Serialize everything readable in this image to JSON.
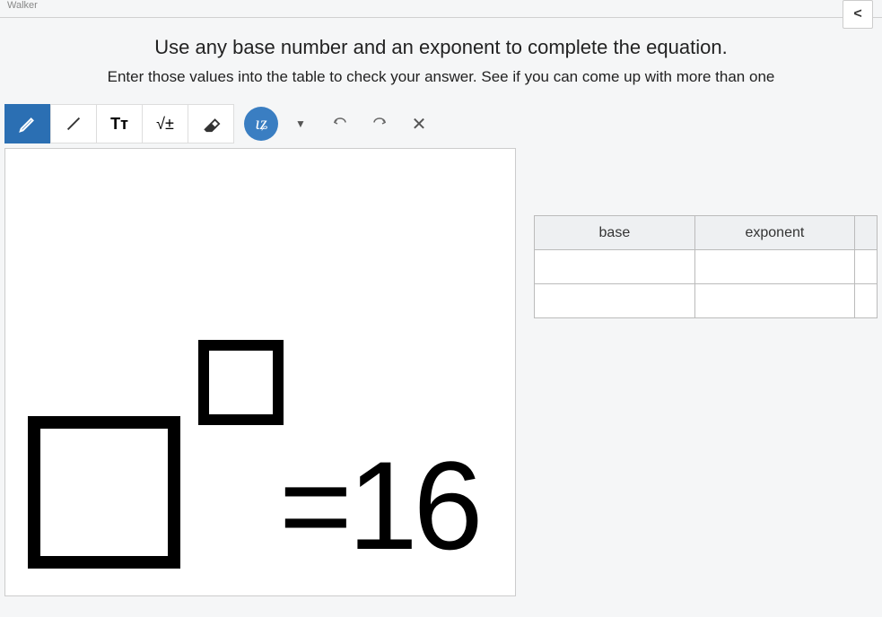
{
  "top": {
    "name_fragment": "Walker"
  },
  "nav": {
    "back": "<"
  },
  "instructions": {
    "line1": "Use any base number and an exponent to complete the equation.",
    "line2": "Enter those values into the table to check your answer.  See if you can come up with more than one"
  },
  "toolbar": {
    "pen": "pen",
    "line": "line",
    "text_tool": "Tᴛ",
    "math": "√±",
    "eraser": "eraser",
    "scribble": "scribble",
    "dropdown": "▼",
    "undo": "undo",
    "redo": "redo",
    "clear": "✕"
  },
  "equation": {
    "equals_value": "=16"
  },
  "table": {
    "col1": "base",
    "col2": "exponent"
  }
}
